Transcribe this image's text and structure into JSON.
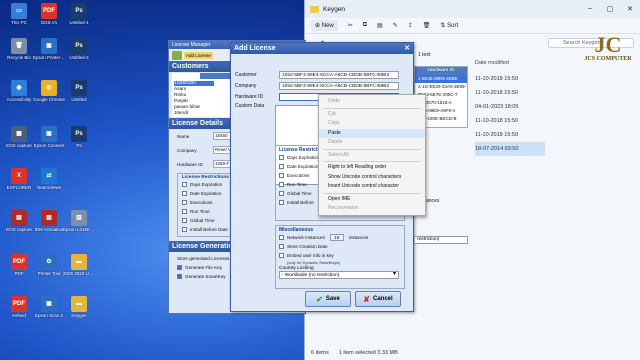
{
  "desktop": {
    "icons": [
      {
        "label": "This PC",
        "color": "#3a7bd5",
        "glyph": "▭"
      },
      {
        "label": "GDS.V1",
        "color": "#d9342b",
        "glyph": "PDF"
      },
      {
        "label": "Untitled-1",
        "color": "#1a3b6e",
        "glyph": "Ps"
      },
      {
        "label": "Recycle Bin",
        "color": "#7b8ca6",
        "glyph": "🗑"
      },
      {
        "label": "Epson Printer Connection...",
        "color": "#2c6fc2",
        "glyph": "▣"
      },
      {
        "label": "Untitled-2",
        "color": "#1a3b6e",
        "glyph": "Ps"
      },
      {
        "label": "Accessibility",
        "color": "#2d7fd8",
        "glyph": "◉"
      },
      {
        "label": "Google Chrome",
        "color": "#e8b225",
        "glyph": "◎"
      },
      {
        "label": "Untitled",
        "color": "#1a3b6e",
        "glyph": "Ps"
      },
      {
        "label": "EOS capture",
        "color": "#4b5e7c",
        "glyph": "▦"
      },
      {
        "label": "Epson Connect",
        "color": "#2c6fc2",
        "glyph": "▣"
      },
      {
        "label": "Ps",
        "color": "#1a3b6e",
        "glyph": "Ps"
      },
      {
        "label": "EXPLORER",
        "color": "#d9342b",
        "glyph": "X"
      },
      {
        "label": "TeamViewer",
        "color": "#1e78d2",
        "glyph": "⇄"
      },
      {
        "label": "EOS capture",
        "color": "#b02a2a",
        "glyph": "▤"
      },
      {
        "label": "IDM Activation",
        "color": "#b02a2a",
        "glyph": "▤"
      },
      {
        "label": "Epson L3150 Scan",
        "color": "#7f8fa8",
        "glyph": "▥"
      },
      {
        "label": "PDF",
        "color": "#d9342b",
        "glyph": "PDF"
      },
      {
        "label": "Printer Tool",
        "color": "#2c6fc2",
        "glyph": "⚙"
      },
      {
        "label": "2026 2023 UNCK",
        "color": "#e5b53a",
        "glyph": "▬"
      },
      {
        "label": "embed",
        "color": "#d9342b",
        "glyph": "PDF"
      },
      {
        "label": "Epson Scan 2",
        "color": "#2c6fc2",
        "glyph": "▣"
      },
      {
        "label": "Keygen",
        "color": "#e5b53a",
        "glyph": "▬"
      }
    ]
  },
  "explorer": {
    "title": "Keygen",
    "toolbar": {
      "new": "New",
      "sort": "Sort"
    },
    "search_placeholder": "Search Keygen",
    "date_header": "Date modified",
    "dates": [
      "11-10-2018 15:50",
      "11-10-2018 15:50",
      "04-01-2023 18:05",
      "11-10-2018 15:50",
      "11-10-2018 15:50",
      "18-07-2014 03:50"
    ],
    "status": {
      "items": "6 items",
      "selected": "1 item selected  3.33 MB"
    }
  },
  "brand": {
    "logo": "JC",
    "text": "JCS COMPUTER"
  },
  "license_manager": {
    "title": "License Manager",
    "toolbar_label": "Add License",
    "customers_title": "Customers",
    "name_header": "Name",
    "customers": [
      "1S450180",
      "Asam",
      "Rinku",
      "Parjab",
      "pawan bihar",
      "Jitendr"
    ],
    "details_title": "License Details",
    "rows": [
      {
        "label": "Name",
        "value": "15450"
      },
      {
        "label": "Company",
        "value": "Reset V"
      },
      {
        "label": "Hardware ID",
        "value": "1058-F"
      }
    ],
    "restrictions_title": "License Restrictions",
    "restrictions": [
      "Days Expiration",
      "Date Expiration",
      "Executions",
      "Run Time",
      "Global Time",
      "Install Before Date"
    ],
    "generation_title": "License Generation",
    "store_text": "Store generated Licenses",
    "generate": [
      "Generate File Key",
      "Generate SmartKey"
    ]
  },
  "add_license": {
    "title": "Add License",
    "customer_label": "Customer",
    "customer_value": "1052-5BF4-89E4-5CCA-A6CB-CBDB-5BFC-B8B2",
    "company_label": "Company",
    "company_value": "1052-5BF4-89E4-5CCA-A6CB-CBDB-5BFC-B8B2",
    "hardware_label": "Hardware ID",
    "hardware_value": "",
    "custom_label": "Custom Data",
    "restrictions_title": "License Restrictions",
    "restrictions": [
      "Days Expiration",
      "Date Expiration",
      "Executions",
      "Run Time",
      "Global Time",
      "Install Before"
    ],
    "misc_title": "Miscellaneous",
    "network_label": "Network Instances",
    "network_value": "16",
    "instances_label": "instances",
    "store_creation": "Store Creation Date",
    "embed_label": "Embed user info in key",
    "embed_note": "(only for Dynamic SmartKeys)",
    "country_label": "Country Locking",
    "country_value": "- Worldwide (no restriction)",
    "save": "Save",
    "cancel": "Cancel",
    "side_text": "1 text",
    "side_restriction": "restriction)",
    "side_ances": "ances"
  },
  "license_table": {
    "header": "Hardware ID",
    "rows": [
      "1-5E45-39D9-4D5E",
      "2-1G-EE29-22A0-3E69-C",
      "7C63-6E7E-290C-7",
      "B4-D570-1515-A",
      "EC5-09E9-A8F9-4",
      "E18-180E-BECD-B"
    ]
  },
  "context_menu": {
    "items": [
      {
        "label": "Undo",
        "enabled": false
      },
      {
        "sep": true
      },
      {
        "label": "Cut",
        "enabled": false
      },
      {
        "label": "Copy",
        "enabled": false
      },
      {
        "label": "Paste",
        "enabled": true,
        "hover": true
      },
      {
        "label": "Delete",
        "enabled": false
      },
      {
        "sep": true
      },
      {
        "label": "Select All",
        "enabled": false
      },
      {
        "sep": true
      },
      {
        "label": "Right to left Reading order",
        "enabled": true
      },
      {
        "label": "Show Unicode control characters",
        "enabled": true
      },
      {
        "label": "Insert Unicode control character",
        "enabled": true,
        "submenu": true
      },
      {
        "sep": true
      },
      {
        "label": "Open IME",
        "enabled": true
      },
      {
        "label": "Reconversion",
        "enabled": false
      }
    ]
  }
}
